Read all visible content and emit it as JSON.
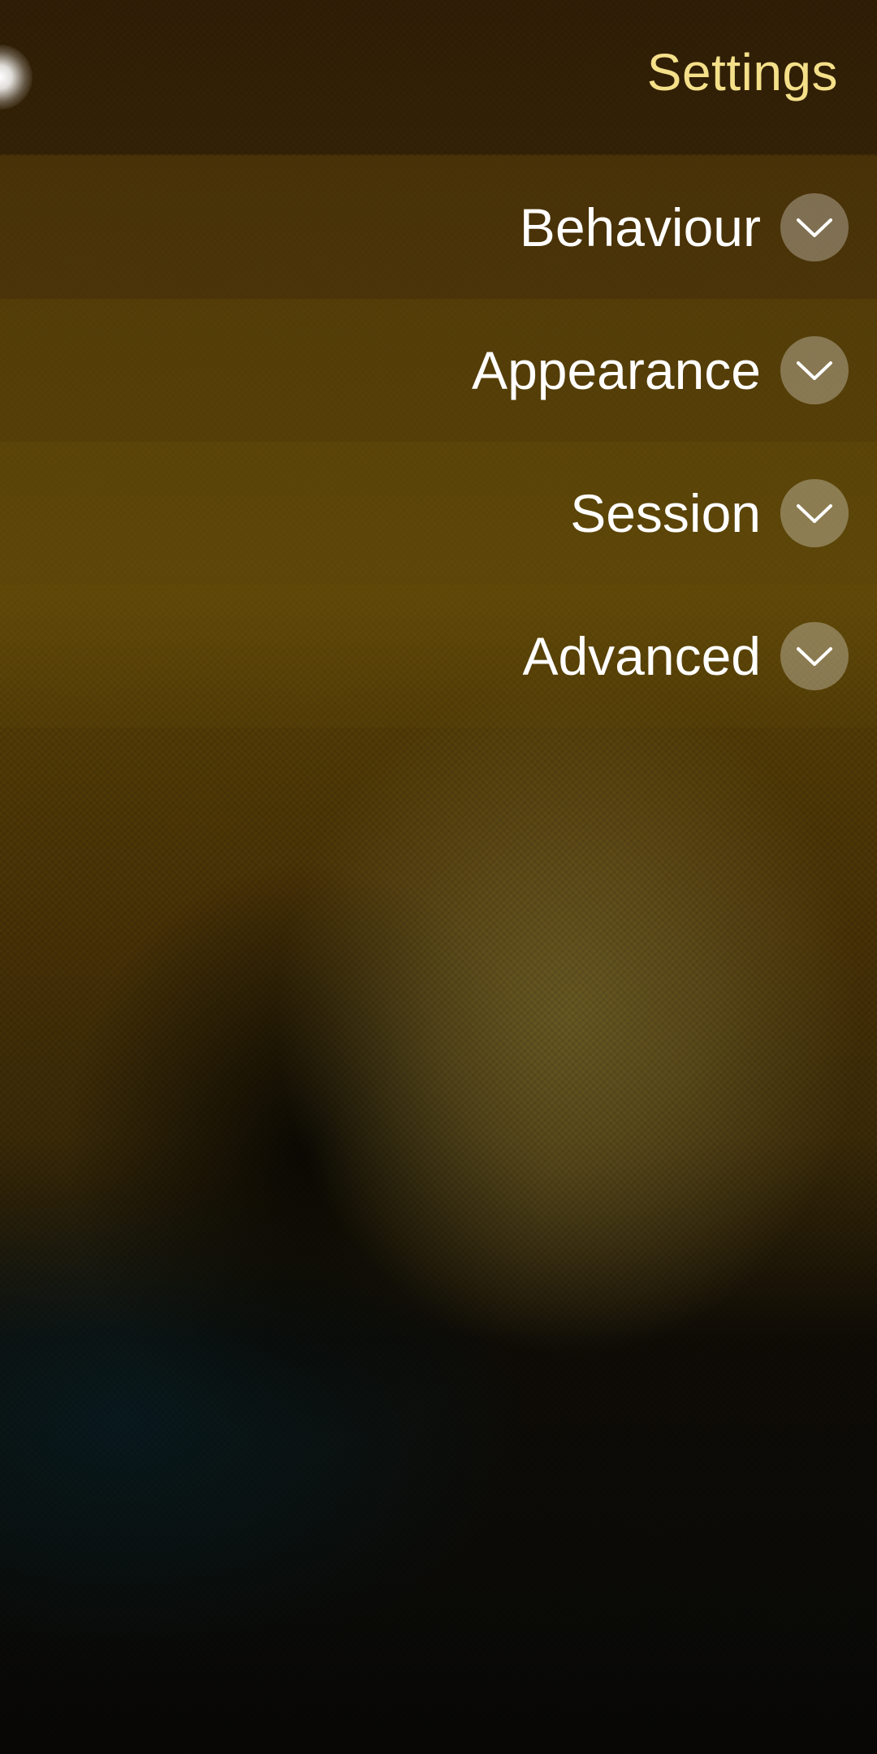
{
  "header": {
    "title": "Settings"
  },
  "sections": [
    {
      "label": "Behaviour",
      "icon": "chevron-down-icon"
    },
    {
      "label": "Appearance",
      "icon": "chevron-down-icon"
    },
    {
      "label": "Session",
      "icon": "chevron-down-icon"
    },
    {
      "label": "Advanced",
      "icon": "chevron-down-icon"
    }
  ],
  "colors": {
    "title": "#f5e08a",
    "label": "#ffffff",
    "button_bg": "rgba(255,255,255,0.3)"
  }
}
